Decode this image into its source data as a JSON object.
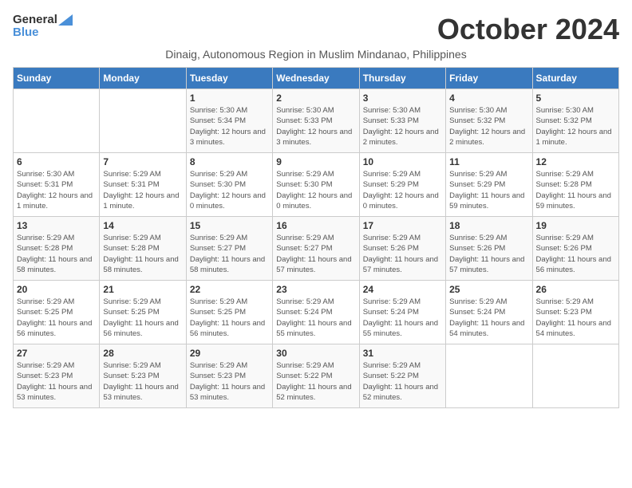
{
  "logo": {
    "line1": "General",
    "line2": "Blue"
  },
  "title": "October 2024",
  "subtitle": "Dinaig, Autonomous Region in Muslim Mindanao, Philippines",
  "days_of_week": [
    "Sunday",
    "Monday",
    "Tuesday",
    "Wednesday",
    "Thursday",
    "Friday",
    "Saturday"
  ],
  "weeks": [
    [
      {
        "day": "",
        "info": ""
      },
      {
        "day": "",
        "info": ""
      },
      {
        "day": "1",
        "info": "Sunrise: 5:30 AM\nSunset: 5:34 PM\nDaylight: 12 hours and 3 minutes."
      },
      {
        "day": "2",
        "info": "Sunrise: 5:30 AM\nSunset: 5:33 PM\nDaylight: 12 hours and 3 minutes."
      },
      {
        "day": "3",
        "info": "Sunrise: 5:30 AM\nSunset: 5:33 PM\nDaylight: 12 hours and 2 minutes."
      },
      {
        "day": "4",
        "info": "Sunrise: 5:30 AM\nSunset: 5:32 PM\nDaylight: 12 hours and 2 minutes."
      },
      {
        "day": "5",
        "info": "Sunrise: 5:30 AM\nSunset: 5:32 PM\nDaylight: 12 hours and 1 minute."
      }
    ],
    [
      {
        "day": "6",
        "info": "Sunrise: 5:30 AM\nSunset: 5:31 PM\nDaylight: 12 hours and 1 minute."
      },
      {
        "day": "7",
        "info": "Sunrise: 5:29 AM\nSunset: 5:31 PM\nDaylight: 12 hours and 1 minute."
      },
      {
        "day": "8",
        "info": "Sunrise: 5:29 AM\nSunset: 5:30 PM\nDaylight: 12 hours and 0 minutes."
      },
      {
        "day": "9",
        "info": "Sunrise: 5:29 AM\nSunset: 5:30 PM\nDaylight: 12 hours and 0 minutes."
      },
      {
        "day": "10",
        "info": "Sunrise: 5:29 AM\nSunset: 5:29 PM\nDaylight: 12 hours and 0 minutes."
      },
      {
        "day": "11",
        "info": "Sunrise: 5:29 AM\nSunset: 5:29 PM\nDaylight: 11 hours and 59 minutes."
      },
      {
        "day": "12",
        "info": "Sunrise: 5:29 AM\nSunset: 5:28 PM\nDaylight: 11 hours and 59 minutes."
      }
    ],
    [
      {
        "day": "13",
        "info": "Sunrise: 5:29 AM\nSunset: 5:28 PM\nDaylight: 11 hours and 58 minutes."
      },
      {
        "day": "14",
        "info": "Sunrise: 5:29 AM\nSunset: 5:28 PM\nDaylight: 11 hours and 58 minutes."
      },
      {
        "day": "15",
        "info": "Sunrise: 5:29 AM\nSunset: 5:27 PM\nDaylight: 11 hours and 58 minutes."
      },
      {
        "day": "16",
        "info": "Sunrise: 5:29 AM\nSunset: 5:27 PM\nDaylight: 11 hours and 57 minutes."
      },
      {
        "day": "17",
        "info": "Sunrise: 5:29 AM\nSunset: 5:26 PM\nDaylight: 11 hours and 57 minutes."
      },
      {
        "day": "18",
        "info": "Sunrise: 5:29 AM\nSunset: 5:26 PM\nDaylight: 11 hours and 57 minutes."
      },
      {
        "day": "19",
        "info": "Sunrise: 5:29 AM\nSunset: 5:26 PM\nDaylight: 11 hours and 56 minutes."
      }
    ],
    [
      {
        "day": "20",
        "info": "Sunrise: 5:29 AM\nSunset: 5:25 PM\nDaylight: 11 hours and 56 minutes."
      },
      {
        "day": "21",
        "info": "Sunrise: 5:29 AM\nSunset: 5:25 PM\nDaylight: 11 hours and 56 minutes."
      },
      {
        "day": "22",
        "info": "Sunrise: 5:29 AM\nSunset: 5:25 PM\nDaylight: 11 hours and 56 minutes."
      },
      {
        "day": "23",
        "info": "Sunrise: 5:29 AM\nSunset: 5:24 PM\nDaylight: 11 hours and 55 minutes."
      },
      {
        "day": "24",
        "info": "Sunrise: 5:29 AM\nSunset: 5:24 PM\nDaylight: 11 hours and 55 minutes."
      },
      {
        "day": "25",
        "info": "Sunrise: 5:29 AM\nSunset: 5:24 PM\nDaylight: 11 hours and 54 minutes."
      },
      {
        "day": "26",
        "info": "Sunrise: 5:29 AM\nSunset: 5:23 PM\nDaylight: 11 hours and 54 minutes."
      }
    ],
    [
      {
        "day": "27",
        "info": "Sunrise: 5:29 AM\nSunset: 5:23 PM\nDaylight: 11 hours and 53 minutes."
      },
      {
        "day": "28",
        "info": "Sunrise: 5:29 AM\nSunset: 5:23 PM\nDaylight: 11 hours and 53 minutes."
      },
      {
        "day": "29",
        "info": "Sunrise: 5:29 AM\nSunset: 5:23 PM\nDaylight: 11 hours and 53 minutes."
      },
      {
        "day": "30",
        "info": "Sunrise: 5:29 AM\nSunset: 5:22 PM\nDaylight: 11 hours and 52 minutes."
      },
      {
        "day": "31",
        "info": "Sunrise: 5:29 AM\nSunset: 5:22 PM\nDaylight: 11 hours and 52 minutes."
      },
      {
        "day": "",
        "info": ""
      },
      {
        "day": "",
        "info": ""
      }
    ]
  ]
}
